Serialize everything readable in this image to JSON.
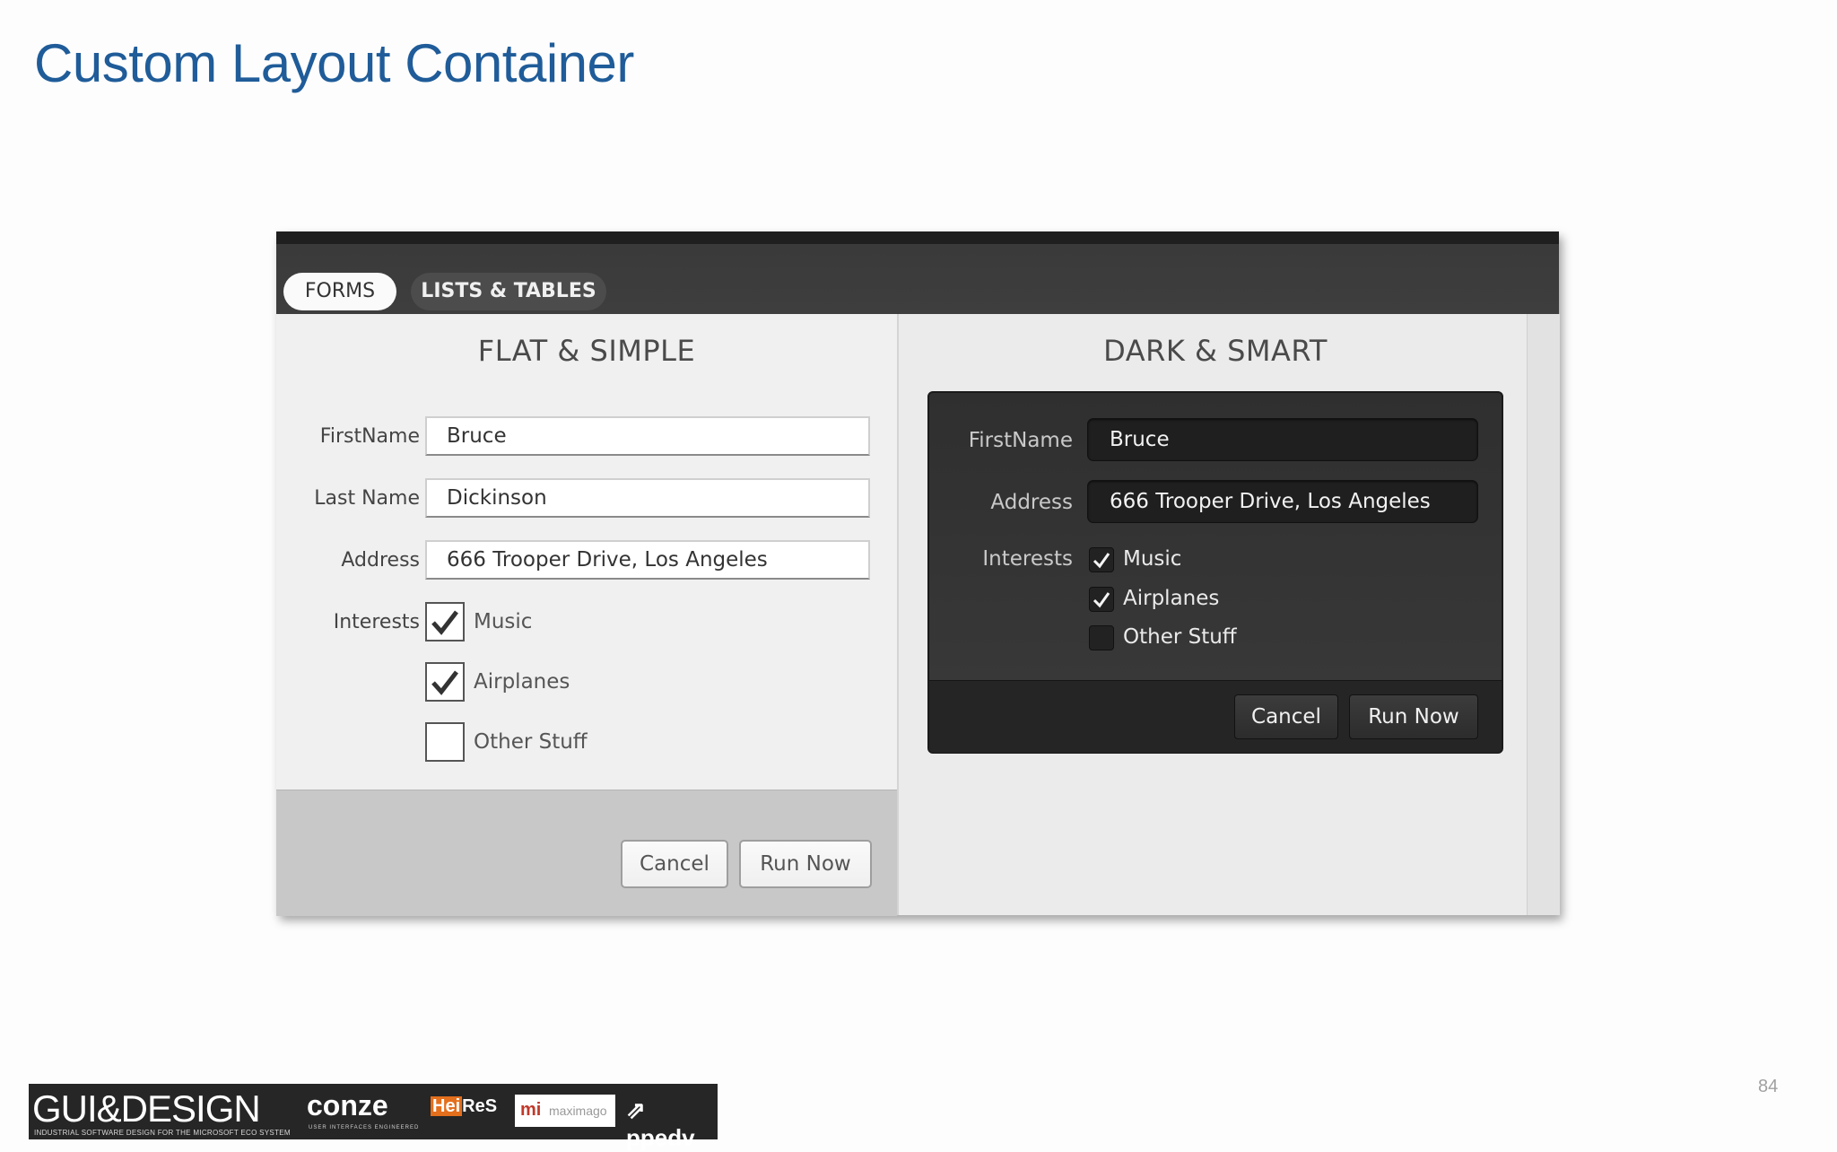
{
  "slide": {
    "title": "Custom Layout Container",
    "page_number": "84"
  },
  "app": {
    "tabs": [
      {
        "label": "FORMS",
        "selected": true
      },
      {
        "label": "LISTS & TABLES",
        "selected": false
      }
    ],
    "flat": {
      "heading": "FLAT & SIMPLE",
      "fields": {
        "first_name": {
          "label": "FirstName",
          "value": "Bruce"
        },
        "last_name": {
          "label": "Last Name",
          "value": "Dickinson"
        },
        "address": {
          "label": "Address",
          "value": "666 Trooper Drive, Los Angeles"
        }
      },
      "interests_label": "Interests",
      "interests": [
        {
          "label": "Music",
          "checked": true
        },
        {
          "label": "Airplanes",
          "checked": true
        },
        {
          "label": "Other Stuff",
          "checked": false
        }
      ],
      "cancel_label": "Cancel",
      "run_label": "Run Now"
    },
    "dark": {
      "heading": "DARK & SMART",
      "fields": {
        "first_name": {
          "label": "FirstName",
          "value": "Bruce"
        },
        "address": {
          "label": "Address",
          "value": "666 Trooper Drive, Los Angeles"
        }
      },
      "interests_label": "Interests",
      "interests": [
        {
          "label": "Music",
          "checked": true
        },
        {
          "label": "Airplanes",
          "checked": true
        },
        {
          "label": "Other Stuff",
          "checked": false
        }
      ],
      "cancel_label": "Cancel",
      "run_label": "Run Now"
    }
  },
  "footer_logos": {
    "gui_design": "GUI&DESIGN",
    "gui_design_tagline": "INDUSTRIAL SOFTWARE DESIGN FOR THE MICROSOFT ECO SYSTEM",
    "conze": "conze",
    "conze_tagline": "USER INTERFACES ENGINEERED",
    "heires_hei": "Hei",
    "heires_res": "ReS",
    "maximago_mark": "mi",
    "maximago_name": "maximago",
    "ppedv": "ppedv"
  },
  "colors": {
    "title_blue": "#1f5c99",
    "app_chrome": "#3a3a3a",
    "heires_orange": "#e46f1c"
  }
}
